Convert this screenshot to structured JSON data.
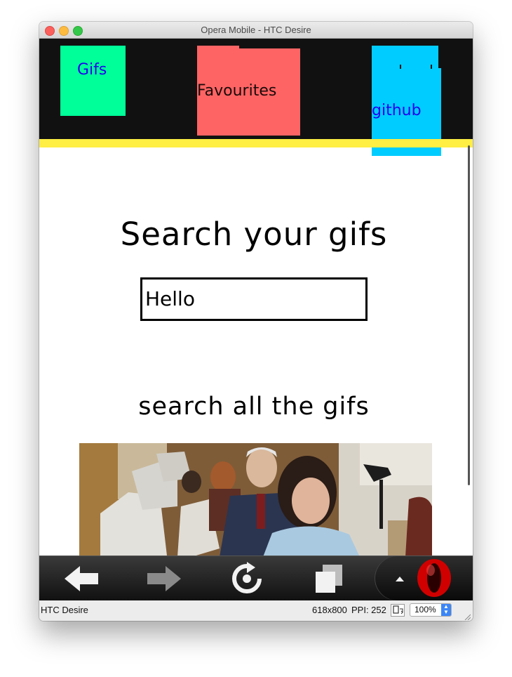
{
  "window": {
    "title": "Opera Mobile - HTC Desire"
  },
  "nav": {
    "gifs_label": "Gifs",
    "favourites_label": "Favourites",
    "github_label": "github"
  },
  "main": {
    "heading": "Search your gifs",
    "search": {
      "value": "Hello",
      "placeholder": ""
    },
    "subheading": "search all the gifs"
  },
  "toolbar": {
    "icons": [
      "back-arrow-icon",
      "forward-arrow-icon",
      "reload-icon",
      "tabs-icon",
      "opera-logo-icon"
    ]
  },
  "status": {
    "device": "HTC Desire",
    "resolution": "618x800",
    "ppi": "PPI: 252",
    "zoom": "100%"
  },
  "colors": {
    "nav_bg": "#111111",
    "nav_gifs": "#00ff99",
    "nav_favourites": "#ff6464",
    "nav_github": "#00ccff",
    "nav_underline": "#ffee44",
    "link": "#2200ee"
  }
}
